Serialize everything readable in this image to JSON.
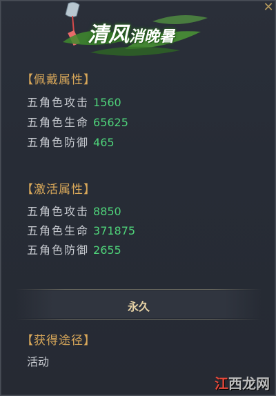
{
  "header": {
    "title_big": "清风",
    "title_small": "消晚暑"
  },
  "worn_attributes": {
    "title": "【佩戴属性】",
    "items": [
      {
        "name": "五角色攻击",
        "value": "1560"
      },
      {
        "name": "五角色生命",
        "value": "65625"
      },
      {
        "name": "五角色防御",
        "value": "465"
      }
    ]
  },
  "active_attributes": {
    "title": "【激活属性】",
    "items": [
      {
        "name": "五角色攻击",
        "value": "8850"
      },
      {
        "name": "五角色生命",
        "value": "371875"
      },
      {
        "name": "五角色防御",
        "value": "2655"
      }
    ]
  },
  "duration": "永久",
  "source": {
    "title": "【获得途径】",
    "value": "活动"
  },
  "watermark": {
    "prefix": "江",
    "rest": "西龙网"
  },
  "colors": {
    "section_title": "#d9a85a",
    "value_green": "#4fd47a",
    "label_grey": "#c8cbd1",
    "duration_gold": "#e7d3a6"
  }
}
